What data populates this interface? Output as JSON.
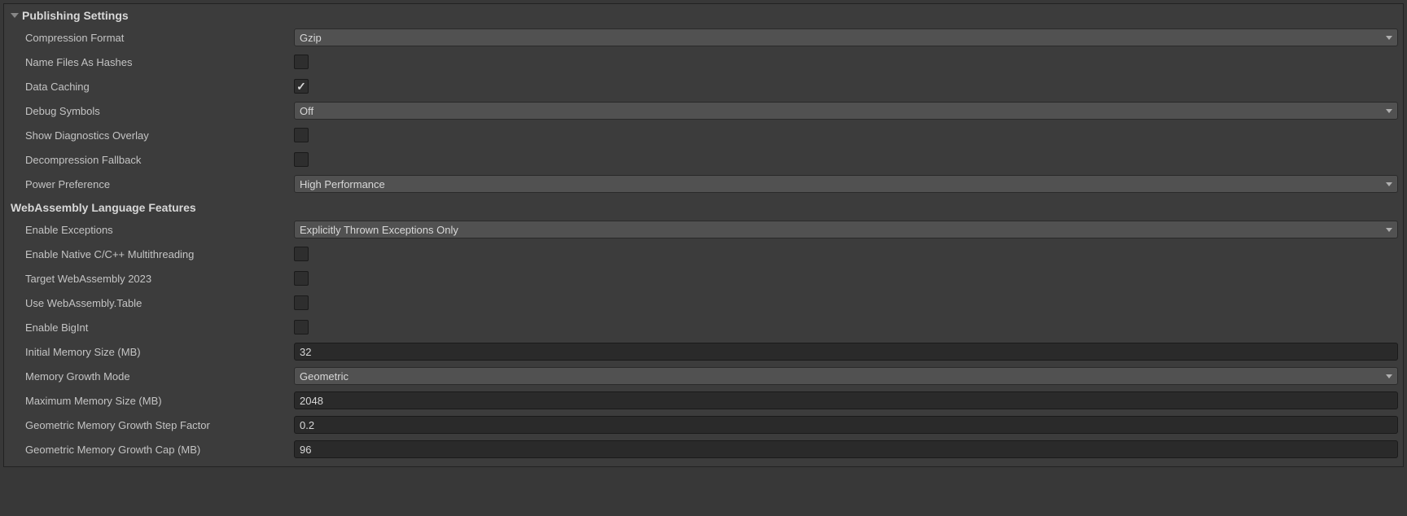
{
  "sections": {
    "publishing": {
      "title": "Publishing Settings",
      "fields": {
        "compression_format": {
          "label": "Compression Format",
          "value": "Gzip"
        },
        "name_files_as_hashes": {
          "label": "Name Files As Hashes",
          "checked": false
        },
        "data_caching": {
          "label": "Data Caching",
          "checked": true
        },
        "debug_symbols": {
          "label": "Debug Symbols",
          "value": "Off"
        },
        "show_diagnostics_overlay": {
          "label": "Show Diagnostics Overlay",
          "checked": false
        },
        "decompression_fallback": {
          "label": "Decompression Fallback",
          "checked": false
        },
        "power_preference": {
          "label": "Power Preference",
          "value": "High Performance"
        }
      }
    },
    "wasm": {
      "title": "WebAssembly Language Features",
      "fields": {
        "enable_exceptions": {
          "label": "Enable Exceptions",
          "value": "Explicitly Thrown Exceptions Only"
        },
        "enable_native_multithreading": {
          "label": "Enable Native C/C++ Multithreading",
          "checked": false
        },
        "target_wasm_2023": {
          "label": "Target WebAssembly 2023",
          "checked": false
        },
        "use_wasm_table": {
          "label": "Use WebAssembly.Table",
          "checked": false
        },
        "enable_bigint": {
          "label": "Enable BigInt",
          "checked": false
        },
        "initial_memory_size": {
          "label": "Initial Memory Size (MB)",
          "value": "32"
        },
        "memory_growth_mode": {
          "label": "Memory Growth Mode",
          "value": "Geometric"
        },
        "maximum_memory_size": {
          "label": "Maximum Memory Size (MB)",
          "value": "2048"
        },
        "geometric_growth_step": {
          "label": "Geometric Memory Growth Step Factor",
          "value": "0.2"
        },
        "geometric_growth_cap": {
          "label": "Geometric Memory Growth Cap (MB)",
          "value": "96"
        }
      }
    }
  }
}
